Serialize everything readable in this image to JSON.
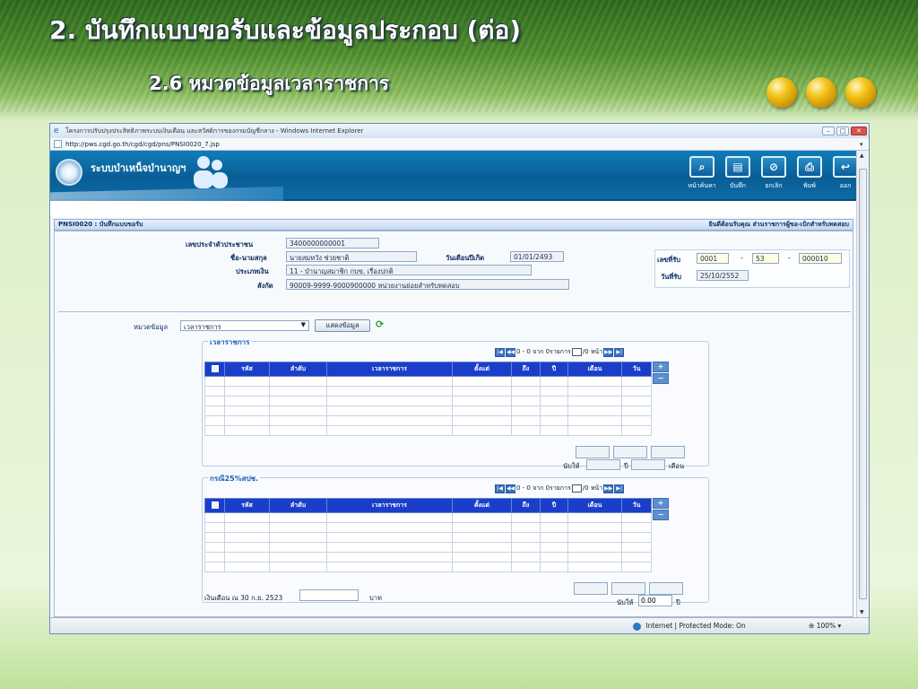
{
  "slide": {
    "title": "2. บันทึกแบบขอรับและข้อมูลประกอบ (ต่อ)",
    "subtitle": "2.6 หมวดข้อมูลเวลาราชการ"
  },
  "browser": {
    "window_title": "โครงการปรับปรุงประสิทธิภาพระบบเงินเดือน และสวัสดิการของกรมบัญชีกลาง - Windows Internet Explorer",
    "url": "http://pws.cgd.go.th/cgd/cgd/pns/PNSI0020_7.jsp",
    "status_zone": "Internet | Protected Mode: On",
    "zoom": "100%"
  },
  "app": {
    "name": "ระบบบำเหน็จบำนาญฯ",
    "toolbar": [
      {
        "label": "หน้าค้นหา",
        "icon": "search-icon"
      },
      {
        "label": "บันทึก",
        "icon": "save-icon"
      },
      {
        "label": "ยกเลิก",
        "icon": "cancel-icon"
      },
      {
        "label": "พิมพ์",
        "icon": "print-icon"
      },
      {
        "label": "ออก",
        "icon": "exit-icon"
      }
    ]
  },
  "form": {
    "code_title": "PNSI0020 : บันทึกแบบขอรับ",
    "welcome": "ยินดีต้อนรับคุณ ส่วนราชการผู้ขอ-เบิกสำหรับทดสอบ",
    "citizen_id_label": "เลขประจำตัวประชาชน",
    "citizen_id": "3400000000001",
    "name_label": "ชื่อ-นามสกุล",
    "name": "นายสมหวัง ช่วยชาติ",
    "birth_label": "วันเดือนปีเกิด",
    "birth": "01/01/2493",
    "money_type_label": "ประเภทเงิน",
    "money_type": "11 - บำนาญสมาชิก กบข. เรื่องปกติ",
    "affiliation_label": "สังกัด",
    "affiliation": "90009-9999-9000900000  หน่วยงานย่อยสำหรับทดสอบ",
    "receive_no_label": "เลขที่รับ",
    "receive_no_1": "0001",
    "receive_no_2": "53",
    "receive_no_3": "000010",
    "receive_date_label": "วันที่รับ",
    "receive_date": "25/10/2552",
    "category_label": "หมวดข้อมูล",
    "category_value": "เวลาราชการ",
    "show_button": "แสดงข้อมูล"
  },
  "grid1": {
    "title": "เวลาราชการ",
    "pager_text": "0 - 0 จาก 0รายการ",
    "page_text": "/0 หน้า",
    "headers": [
      "รหัส",
      "ลำดับ",
      "เวลาราชการ",
      "ตั้งแต่",
      "ถึง",
      "ปี",
      "เดือน",
      "วัน"
    ],
    "footer_label_year": "นับให้",
    "footer_label_y": "ปี",
    "footer_label_month": "เดือน"
  },
  "grid2": {
    "title": "กรณี25%สปช.",
    "pager_text": "0 - 0 จาก 0รายการ",
    "page_text": "/0 หน้า",
    "headers": [
      "รหัส",
      "ลำดับ",
      "เวลาราชการ",
      "ตั้งแต่",
      "ถึง",
      "ปี",
      "เดือน",
      "วัน"
    ],
    "salary_label": "เงินเดือน ณ 30 ก.ย. 2523",
    "baht_label": "บาท",
    "count_label": "นับให้",
    "count_value": "0.00",
    "year_label": "ปี"
  }
}
